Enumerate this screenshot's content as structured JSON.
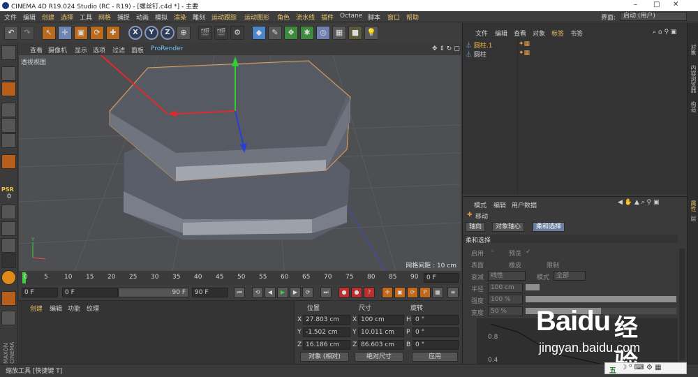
{
  "titlebar": {
    "title": "CINEMA 4D R19.024 Studio (RC - R19) - [螺丝钉.c4d *] - 主要",
    "minimize": "–",
    "maximize": "□",
    "close": "✕"
  },
  "menu": [
    "文件",
    "编辑",
    "创建",
    "选择",
    "工具",
    "网格",
    "捕捉",
    "动画",
    "模拟",
    "渲染",
    "雕刻",
    "运动跟踪",
    "运动图形",
    "角色",
    "流水线",
    "插件",
    "Octane",
    "脚本",
    "窗口",
    "帮助"
  ],
  "interface": {
    "label": "界面:",
    "value": "启动 (用户)"
  },
  "viewport": {
    "menus": [
      "查看",
      "摄像机",
      "显示",
      "选项",
      "过滤",
      "面板",
      "ProRender"
    ],
    "label": "透视视图",
    "grid_spacing": "网格间距 : 10 cm"
  },
  "timeline": {
    "ticks": [
      "0",
      "5",
      "10",
      "15",
      "20",
      "25",
      "30",
      "35",
      "40",
      "45",
      "50",
      "55",
      "60",
      "65",
      "70",
      "75",
      "80",
      "85",
      "90"
    ],
    "end_label": "0 F"
  },
  "transport": {
    "start": "0 F",
    "range_start": "0 F",
    "range_end": "90 F",
    "end": "90 F"
  },
  "material_manager": {
    "menus": [
      "创建",
      "编辑",
      "功能",
      "纹理"
    ]
  },
  "coords": {
    "headers": {
      "position": "位置",
      "size": "尺寸",
      "rotation": "旋转"
    },
    "rows": [
      {
        "axis": "X",
        "pos": "27.803 cm",
        "size_axis": "X",
        "size": "100 cm",
        "rot_axis": "H",
        "rot": "0 °"
      },
      {
        "axis": "Y",
        "pos": "-1.502 cm",
        "size_axis": "Y",
        "size": "10.011 cm",
        "rot_axis": "P",
        "rot": "0 °"
      },
      {
        "axis": "Z",
        "pos": "16.186 cm",
        "size_axis": "Z",
        "size": "86.603 cm",
        "rot_axis": "B",
        "rot": "0 °"
      }
    ],
    "mode": "对象 (相对)",
    "size_mode": "绝对尺寸",
    "apply": "应用"
  },
  "object_manager": {
    "menus": [
      "文件",
      "编辑",
      "查看",
      "对象",
      "标签",
      "书签"
    ],
    "objects": [
      {
        "name": "圆柱.1",
        "selected": true
      },
      {
        "name": "圆柱",
        "selected": false
      }
    ]
  },
  "attribute_manager": {
    "menus": [
      "模式",
      "编辑",
      "用户数据"
    ],
    "tool_name": "移动",
    "tabs": [
      "轴向",
      "对象轴心",
      "柔和选择"
    ],
    "active_tab": "柔和选择",
    "section": "柔和选择",
    "rows": {
      "enable": "启用",
      "preview": "预览",
      "surface": "表面",
      "rubber": "橡皮",
      "limit": "限制",
      "falloff": "衰减",
      "falloff_value": "线性",
      "mode": "模式",
      "mode_value": "全部",
      "radius": "半径",
      "radius_value": "100 cm",
      "strength": "强度",
      "strength_value": "100 %",
      "width": "宽度",
      "width_value": "50 %",
      "graph_ticks": [
        "0.8",
        "0.4"
      ]
    }
  },
  "right_tabs": [
    "对象",
    "内容浏览器",
    "构造",
    "属性",
    "层"
  ],
  "statusbar": "缩放工具 [快捷键 T]",
  "watermark": {
    "brand": "Baidu",
    "brand_cn": "经验",
    "url": "jingyan.baidu.com"
  },
  "ime": {
    "label": "五"
  },
  "psr_label": "PSR",
  "psr_value": "0",
  "maxon_label": "MAXON CINEMA"
}
